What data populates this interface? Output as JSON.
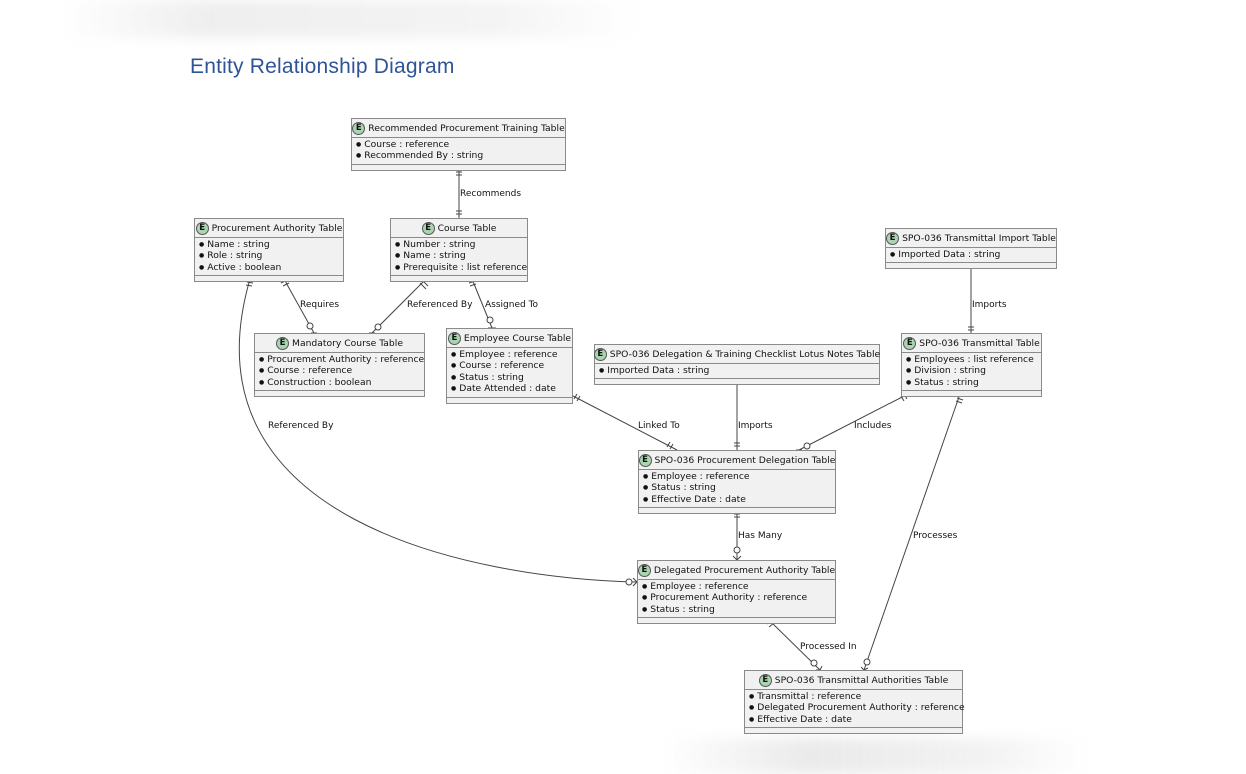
{
  "title": "Entity Relationship Diagram",
  "entity_badge": "E",
  "entities": [
    {
      "name": "Recommended Procurement Training Table",
      "attributes": [
        "Course : reference",
        "Recommended By : string"
      ]
    },
    {
      "name": "Procurement Authority Table",
      "attributes": [
        "Name : string",
        "Role : string",
        "Active : boolean"
      ]
    },
    {
      "name": "Course Table",
      "attributes": [
        "Number : string",
        "Name : string",
        "Prerequisite : list reference"
      ]
    },
    {
      "name": "Mandatory Course Table",
      "attributes": [
        "Procurement Authority : reference",
        "Course : reference",
        "Construction : boolean"
      ]
    },
    {
      "name": "Employee Course Table",
      "attributes": [
        "Employee : reference",
        "Course : reference",
        "Status : string",
        "Date Attended : date"
      ]
    },
    {
      "name": "SPO-036 Delegation & Training Checklist Lotus Notes Table",
      "attributes": [
        "Imported Data : string"
      ]
    },
    {
      "name": "SPO-036 Transmittal Import Table",
      "attributes": [
        "Imported Data : string"
      ]
    },
    {
      "name": "SPO-036 Transmittal Table",
      "attributes": [
        "Employees : list reference",
        "Division : string",
        "Status : string"
      ]
    },
    {
      "name": "SPO-036 Procurement Delegation Table",
      "attributes": [
        "Employee : reference",
        "Status : string",
        "Effective Date : date"
      ]
    },
    {
      "name": "Delegated Procurement Authority Table",
      "attributes": [
        "Employee : reference",
        "Procurement Authority : reference",
        "Status : string"
      ]
    },
    {
      "name": "SPO-036 Transmittal Authorities Table",
      "attributes": [
        "Transmittal : reference",
        "Delegated Procurement Authority : reference",
        "Effective Date : date"
      ]
    }
  ],
  "relationships": [
    {
      "from": "Recommended Procurement Training Table",
      "to": "Course Table",
      "label": "Recommends"
    },
    {
      "from": "Procurement Authority Table",
      "to": "Mandatory Course Table",
      "label": "Requires"
    },
    {
      "from": "Course Table",
      "to": "Mandatory Course Table",
      "label": "Referenced By"
    },
    {
      "from": "Course Table",
      "to": "Employee Course Table",
      "label": "Assigned To"
    },
    {
      "from": "Procurement Authority Table",
      "to": "Delegated Procurement Authority Table",
      "label": "Referenced By"
    },
    {
      "from": "Employee Course Table",
      "to": "SPO-036 Procurement Delegation Table",
      "label": "Linked To"
    },
    {
      "from": "SPO-036 Delegation & Training Checklist Lotus Notes Table",
      "to": "SPO-036 Procurement Delegation Table",
      "label": "Imports"
    },
    {
      "from": "SPO-036 Transmittal Table",
      "to": "SPO-036 Procurement Delegation Table",
      "label": "Includes"
    },
    {
      "from": "SPO-036 Transmittal Import Table",
      "to": "SPO-036 Transmittal Table",
      "label": "Imports"
    },
    {
      "from": "SPO-036 Procurement Delegation Table",
      "to": "Delegated Procurement Authority Table",
      "label": "Has Many"
    },
    {
      "from": "SPO-036 Transmittal Table",
      "to": "SPO-036 Transmittal Authorities Table",
      "label": "Processes"
    },
    {
      "from": "Delegated Procurement Authority Table",
      "to": "SPO-036 Transmittal Authorities Table",
      "label": "Processed In"
    }
  ]
}
